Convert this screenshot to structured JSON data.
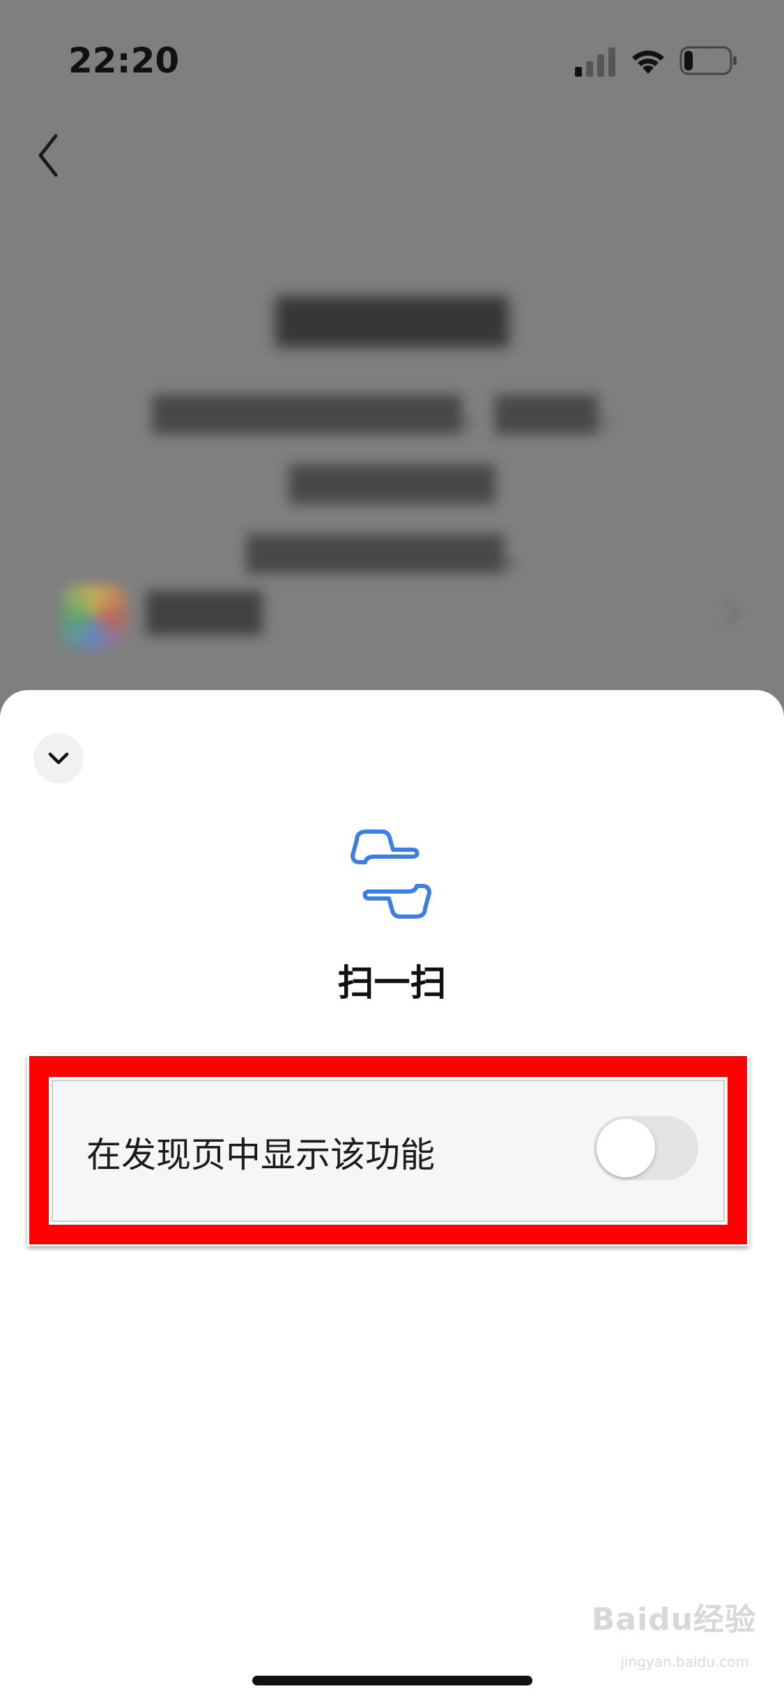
{
  "status_bar": {
    "time": "22:20",
    "signal_icon": "cellular-signal-icon",
    "wifi_icon": "wifi-icon",
    "battery_icon": "battery-low-icon"
  },
  "nav": {
    "back_icon": "chevron-left-icon"
  },
  "background": {
    "title": "███████",
    "description_line1": "████████████，████，████████",
    "description_line2": "██████████。",
    "app_name": "████"
  },
  "sheet": {
    "collapse_icon": "chevron-down-icon",
    "feature_icon": "scan-icon",
    "feature_name": "扫一扫",
    "setting_label": "在发现页中显示该功能",
    "toggle_on": false,
    "accent_color": "#3b7fe0",
    "highlight_color": "#ff0000"
  },
  "watermark": {
    "text": "Baidu经验",
    "url_text": "jingyan.baidu.com"
  }
}
